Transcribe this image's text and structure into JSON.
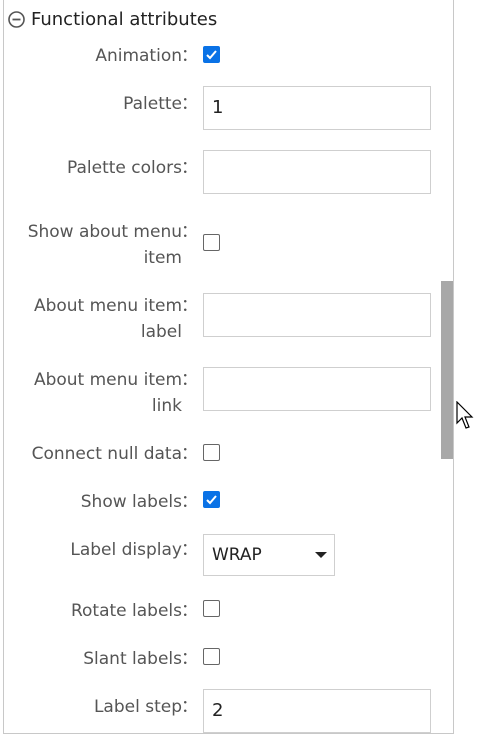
{
  "section": {
    "title": "Functional attributes",
    "icon": "collapse-minus-icon"
  },
  "colon": "：",
  "fields": {
    "animation": {
      "label": "Animation",
      "checked": true
    },
    "palette": {
      "label": "Palette",
      "value": "1"
    },
    "palette_colors": {
      "label": "Palette colors",
      "value": ""
    },
    "show_about_menu_item": {
      "label_line1": "Show about menu",
      "label_line2": "item",
      "checked": false
    },
    "about_menu_item_label": {
      "label_line1": "About menu item",
      "label_line2": "label",
      "value": ""
    },
    "about_menu_item_link": {
      "label_line1": "About menu item",
      "label_line2": "link",
      "value": ""
    },
    "connect_null_data": {
      "label": "Connect null data",
      "checked": false
    },
    "show_labels": {
      "label": "Show labels",
      "checked": true
    },
    "label_display": {
      "label": "Label display",
      "value": "WRAP"
    },
    "rotate_labels": {
      "label": "Rotate labels",
      "checked": false
    },
    "slant_labels": {
      "label": "Slant labels",
      "checked": false
    },
    "label_step": {
      "label": "Label step",
      "value": "2"
    }
  },
  "colors": {
    "checkbox_checked": "#0a72e6",
    "label_text": "#555555",
    "border": "#cfcfcf",
    "scrollbar": "#a8a8a8"
  }
}
